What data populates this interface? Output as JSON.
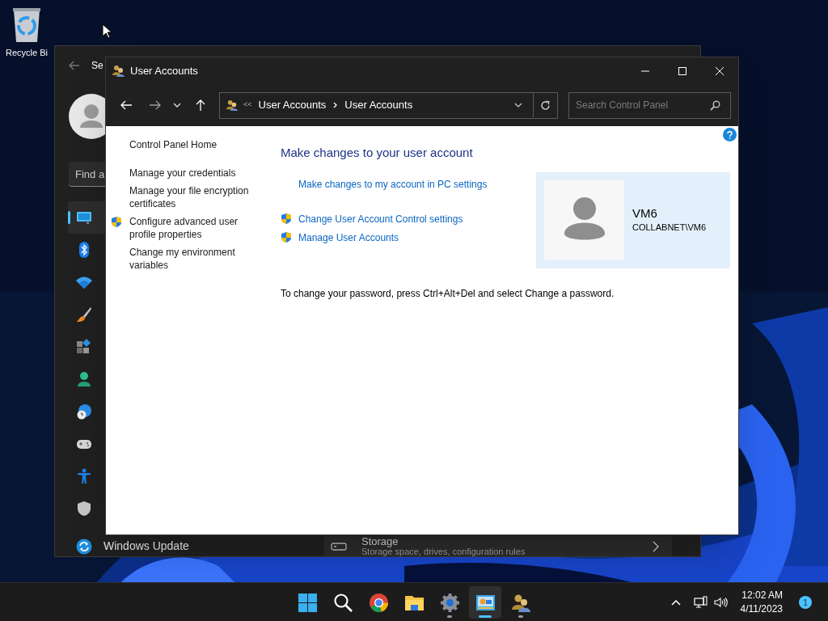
{
  "desktop_icons": [
    {
      "label": "Recycle Bi"
    }
  ],
  "settings_window": {
    "title": "Se",
    "search_placeholder": "Find a",
    "nav_items": [
      {
        "selected": true
      },
      {
        "selected": false
      },
      {
        "selected": false
      },
      {
        "selected": false
      },
      {
        "selected": false
      },
      {
        "selected": false
      },
      {
        "selected": false
      },
      {
        "selected": false
      },
      {
        "selected": false
      },
      {
        "selected": false
      },
      {
        "label": "Windows Update",
        "selected": false
      }
    ],
    "storage": {
      "title": "Storage",
      "description": "Storage space, drives, configuration rules"
    }
  },
  "user_accounts_window": {
    "title": "User Accounts",
    "address_bar": {
      "separator": "<<",
      "items": [
        "User Accounts",
        "User Accounts"
      ]
    },
    "search": {
      "placeholder": "Search Control Panel"
    },
    "left_nav": [
      {
        "label": "Control Panel Home",
        "kind": "link"
      },
      {
        "label": "Manage your credentials",
        "kind": "link"
      },
      {
        "label": "Manage your file encryption certificates",
        "kind": "link"
      },
      {
        "label": "Configure advanced user profile properties",
        "kind": "uac"
      },
      {
        "label": "Change my environment variables",
        "kind": "link"
      }
    ],
    "heading": "Make changes to your user account",
    "links": [
      {
        "label": "Make changes to my account in PC settings",
        "kind": "link"
      },
      {
        "label": "Change User Account Control settings",
        "kind": "uac"
      },
      {
        "label": "Manage User Accounts",
        "kind": "uac"
      }
    ],
    "account": {
      "name": "VM6",
      "domain": "COLLABNET\\VM6"
    },
    "note": "To change your password, press Ctrl+Alt+Del and select Change a password."
  },
  "taskbar": {
    "apps": [
      {
        "kind": "start",
        "running": false,
        "active": false
      },
      {
        "kind": "search",
        "running": false,
        "active": false
      },
      {
        "kind": "browser",
        "running": false,
        "active": false
      },
      {
        "kind": "folder",
        "running": false,
        "active": false
      },
      {
        "kind": "settings",
        "running": true,
        "active": false
      },
      {
        "kind": "control-panel",
        "running": true,
        "active": true
      },
      {
        "kind": "users",
        "running": true,
        "active": false
      }
    ],
    "time": "12:02 AM",
    "date": "4/11/2023",
    "notification_count": "1"
  }
}
